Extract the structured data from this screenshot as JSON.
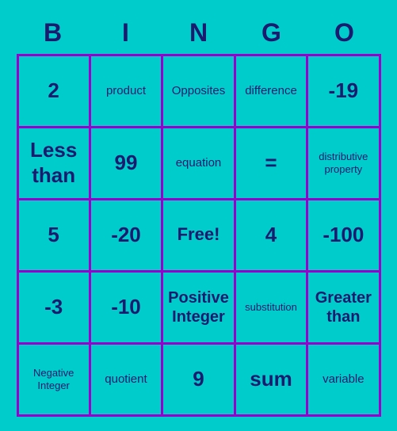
{
  "header": {
    "letters": [
      "B",
      "I",
      "N",
      "G",
      "O"
    ]
  },
  "cells": [
    {
      "text": "2",
      "size": "large"
    },
    {
      "text": "product",
      "size": "normal"
    },
    {
      "text": "Opposites",
      "size": "normal"
    },
    {
      "text": "difference",
      "size": "normal"
    },
    {
      "text": "-19",
      "size": "large"
    },
    {
      "text": "Less than",
      "size": "large"
    },
    {
      "text": "99",
      "size": "large"
    },
    {
      "text": "equation",
      "size": "normal"
    },
    {
      "text": "=",
      "size": "large"
    },
    {
      "text": "distributive property",
      "size": "small"
    },
    {
      "text": "5",
      "size": "large"
    },
    {
      "text": "-20",
      "size": "large"
    },
    {
      "text": "Free!",
      "size": "free"
    },
    {
      "text": "4",
      "size": "large"
    },
    {
      "text": "-100",
      "size": "large"
    },
    {
      "text": "-3",
      "size": "large"
    },
    {
      "text": "-10",
      "size": "large"
    },
    {
      "text": "Positive Integer",
      "size": "medium"
    },
    {
      "text": "substitution",
      "size": "small"
    },
    {
      "text": "Greater than",
      "size": "medium"
    },
    {
      "text": "Negative Integer",
      "size": "small"
    },
    {
      "text": "quotient",
      "size": "normal"
    },
    {
      "text": "9",
      "size": "large"
    },
    {
      "text": "sum",
      "size": "large"
    },
    {
      "text": "variable",
      "size": "normal"
    }
  ]
}
